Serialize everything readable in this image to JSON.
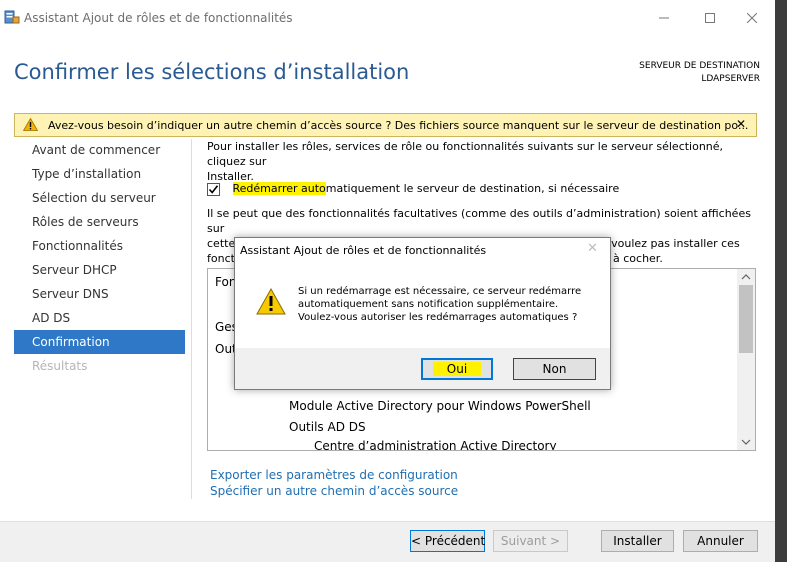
{
  "window": {
    "title": "Assistant Ajout de rôles et de fonctionnalités",
    "icon": "server-manager-icon"
  },
  "header": {
    "page_title": "Confirmer les sélections d’installation",
    "dest_label": "SERVEUR DE DESTINATION",
    "dest_server": "LDAPSERVER"
  },
  "banner": {
    "text": "Avez-vous besoin d’indiquer un autre chemin d’accès source ? Des fichiers source manquent sur le serveur de destination po...",
    "close": "✕"
  },
  "nav": {
    "items": [
      {
        "label": "Avant de commencer",
        "state": "normal"
      },
      {
        "label": "Type d’installation",
        "state": "normal"
      },
      {
        "label": "Sélection du serveur",
        "state": "normal"
      },
      {
        "label": "Rôles de serveurs",
        "state": "normal"
      },
      {
        "label": "Fonctionnalités",
        "state": "normal"
      },
      {
        "label": "Serveur DHCP",
        "state": "normal"
      },
      {
        "label": "Serveur DNS",
        "state": "normal"
      },
      {
        "label": "AD DS",
        "state": "normal"
      },
      {
        "label": "Confirmation",
        "state": "active"
      },
      {
        "label": "Résultats",
        "state": "disabled"
      }
    ]
  },
  "content": {
    "intro_line1": "Pour installer les rôles, services de rôle ou fonctionnalités suivants sur le serveur sélectionné, cliquez sur",
    "intro_line2": "Installer.",
    "restart_checkbox_checked": true,
    "restart_label_part1": "Redémarrer auto",
    "restart_label_part2": "matiquement le serveur de destination, si nécessaire",
    "info_line1": "Il se peut que des fonctionnalités facultatives (comme des outils d’administration) soient affichées sur",
    "info_line2": "cette page, car elles ont été sélectionnées automatiquement. Si vous ne voulez pas installer ces",
    "info_line3_start": "fonct",
    "info_line3_end": "à cocher.",
    "list_items": [
      "Fonc",
      "Ges",
      "Outi",
      "Module Active Directory pour Windows PowerShell",
      "Outils AD DS",
      "Centre d’administration Active Directory"
    ],
    "link_export": "Exporter les paramètres de configuration",
    "link_source": "Spécifier un autre chemin d’accès source"
  },
  "footer": {
    "prev": "< Précédent",
    "next": "Suivant >",
    "install": "Installer",
    "cancel": "Annuler"
  },
  "dialog": {
    "title": "Assistant Ajout de rôles et de fonctionnalités",
    "close": "✕",
    "message_line1": "Si un redémarrage est nécessaire, ce serveur redémarre",
    "message_line2": "automatiquement sans notification supplémentaire.",
    "message_line3": "Voulez-vous autoriser les redémarrages automatiques ?",
    "yes": "Oui",
    "no": "Non"
  },
  "colors": {
    "accent": "#2f78c7",
    "title": "#2a5a92",
    "banner_bg": "#fef3b5",
    "highlight": "#fff200",
    "link": "#1f6fb2"
  }
}
